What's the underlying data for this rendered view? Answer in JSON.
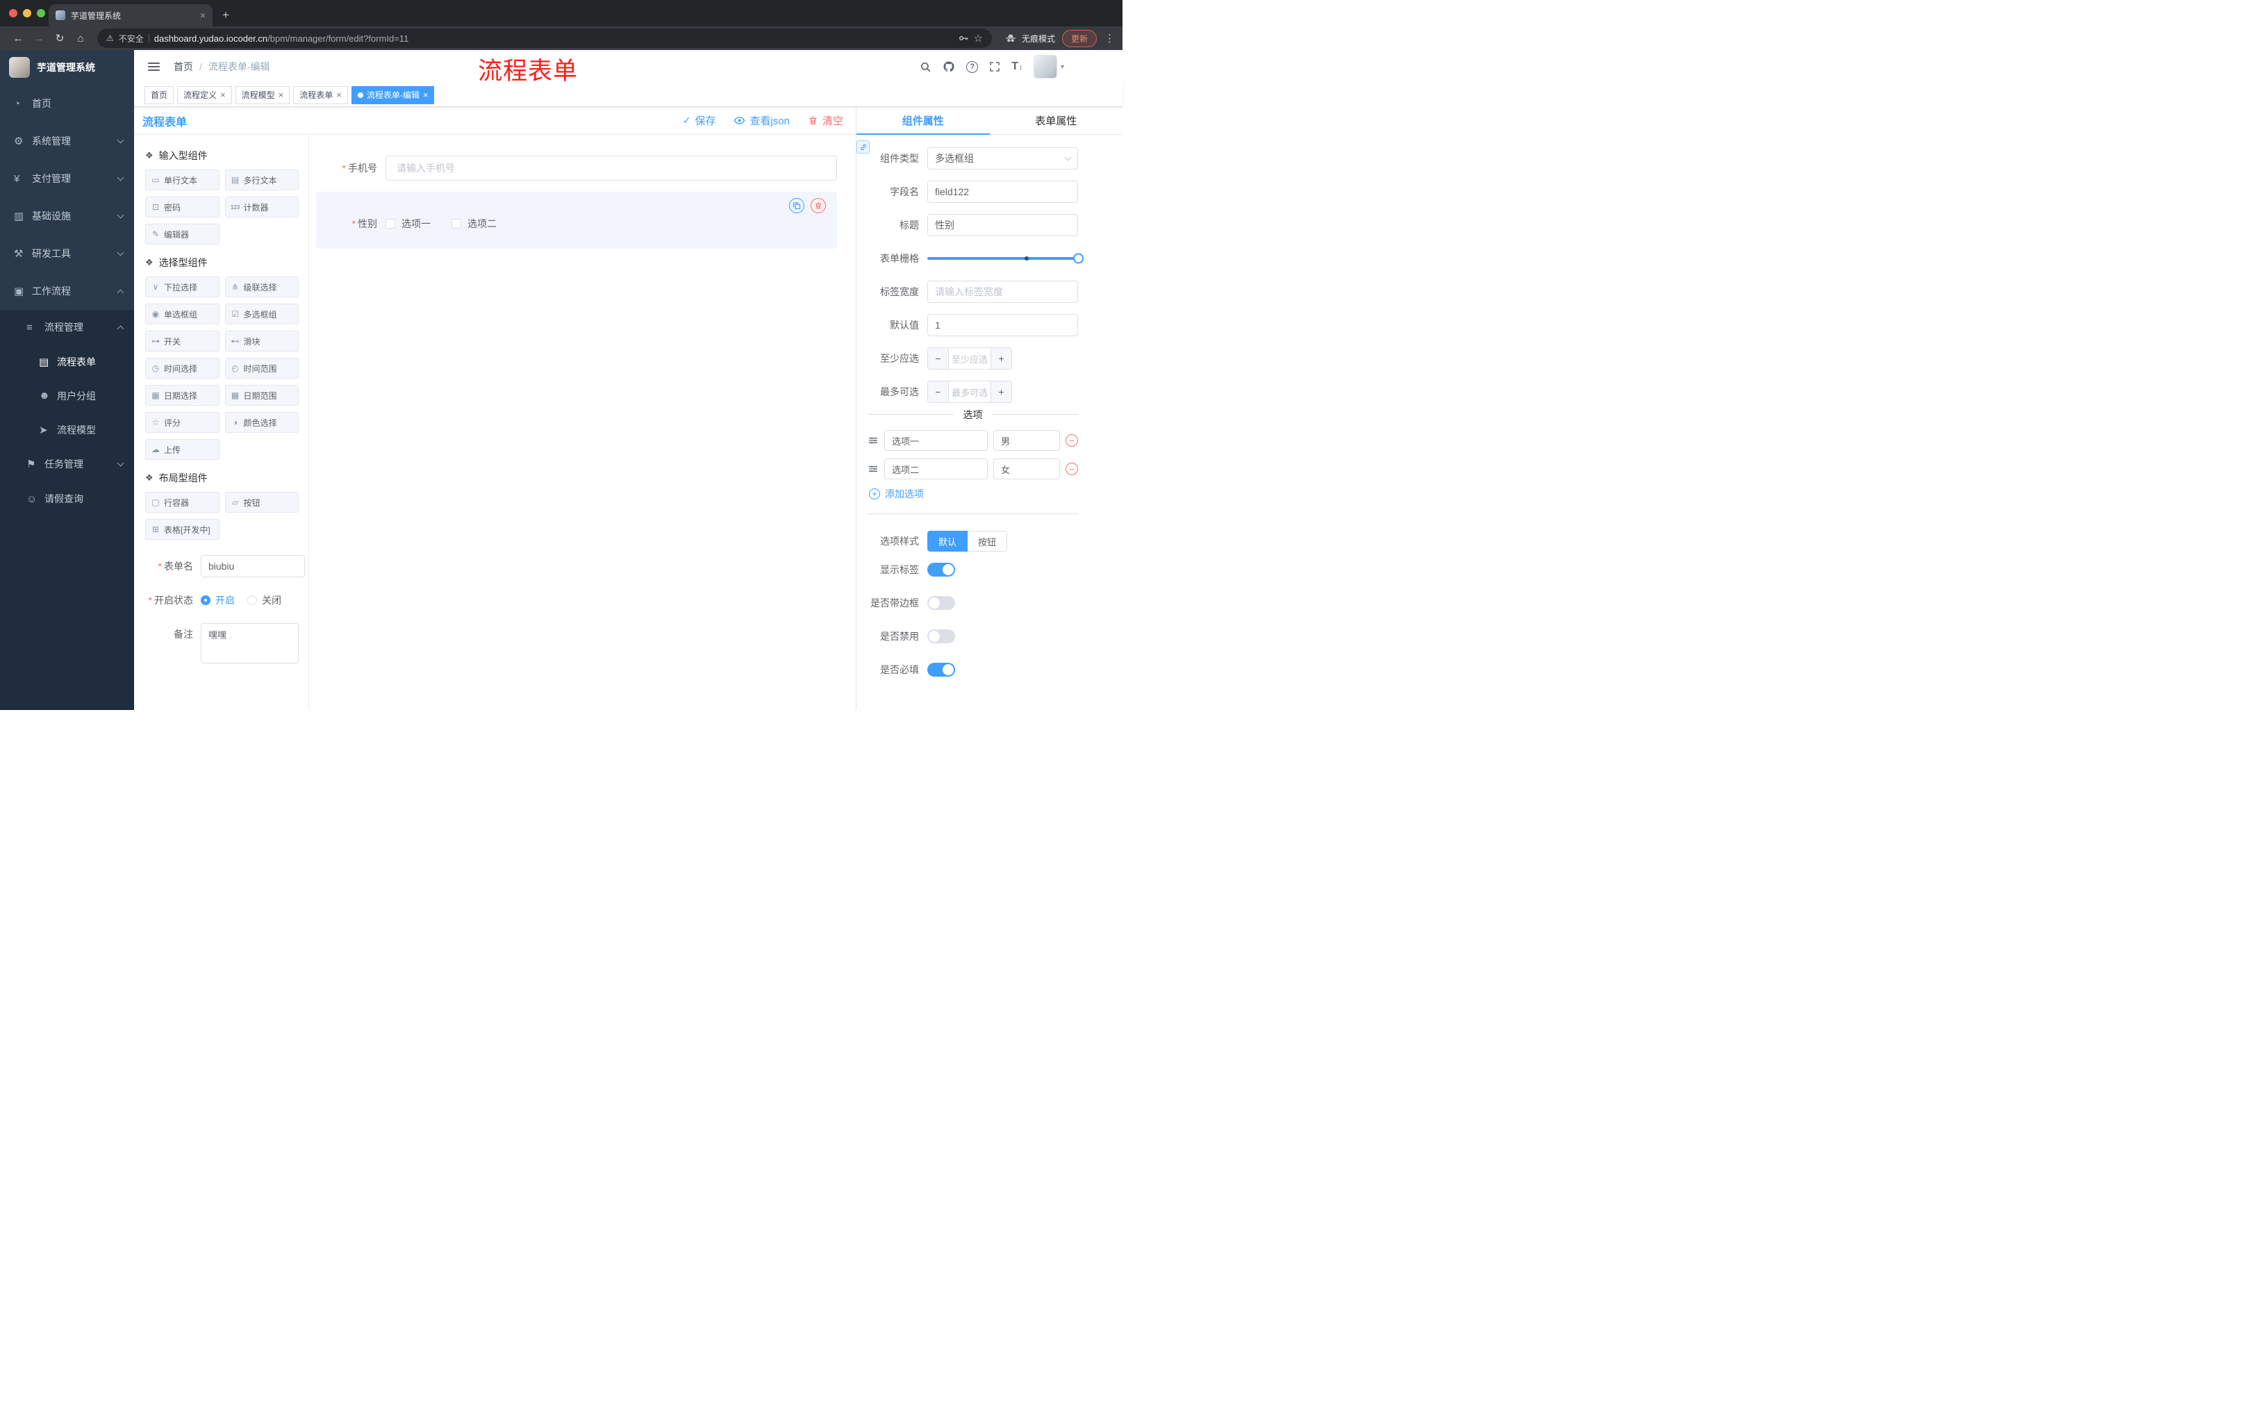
{
  "colors": {
    "accent": "#409eff",
    "danger": "#f56c6c",
    "sidebar_bg": "#2b3a4a",
    "submenu_bg": "#1f2d3c",
    "active_tag": "#409eff",
    "annotation": "#fc1f16"
  },
  "icons": {
    "required": "*",
    "slash": "/",
    "close": "×",
    "plus": "+",
    "minus": "−",
    "check": "✓",
    "dots_menu": "⋮",
    "back": "←",
    "forward": "→",
    "reload": "↻",
    "home": "⌂",
    "warning": "⚠",
    "star": "☆",
    "caret": "▾",
    "question": "?",
    "font_size": "T",
    "font_updown": "↕",
    "dashboard": "◔",
    "gear": "⚙",
    "yen": "¥",
    "monitor": "▥",
    "tools": "⚒",
    "workflow": "▣",
    "list": "≡",
    "doc": "▤",
    "users": "☻",
    "send": "➤",
    "flag": "⚑",
    "user": "☺",
    "component_group": "❖",
    "chip": {
      "single_text": "▭",
      "multi_text": "▤",
      "password": "⊡",
      "counter": "123",
      "editor": "✎",
      "select": "∨",
      "cascade": "⋔",
      "radio": "◉",
      "checkbox": "☑",
      "switch": "⊶",
      "slider": "⊷",
      "time": "◷",
      "time_range": "◴",
      "date": "▦",
      "date_range": "▩",
      "rate": "☆",
      "color": "◑",
      "upload": "☁",
      "row": "▢",
      "button": "▱",
      "table": "⊞"
    }
  },
  "browser": {
    "tab": {
      "title": "芋道管理系统"
    },
    "address": {
      "security": "不安全",
      "url_domain": "dashboard.yudao.iocoder.cn",
      "url_path": "/bpm/manager/form/edit?formId=11",
      "incognito": "无痕模式",
      "update": "更新"
    }
  },
  "sidebar": {
    "title": "芋道管理系统",
    "top_items": [
      "首页",
      "系统管理",
      "支付管理",
      "基础设施",
      "研发工具",
      "工作流程"
    ],
    "sub": {
      "process_group": "流程管理",
      "process_children": [
        "流程表单",
        "用户分组",
        "流程模型"
      ],
      "task_group": "任务管理",
      "leave_item": "请假查询"
    }
  },
  "header": {
    "breadcrumb_home": "首页",
    "breadcrumb_current": "流程表单-编辑",
    "annotation": "流程表单"
  },
  "tags": [
    {
      "label": "首页"
    },
    {
      "label": "流程定义"
    },
    {
      "label": "流程模型"
    },
    {
      "label": "流程表单"
    },
    {
      "label": "流程表单-编辑"
    }
  ],
  "workspace": {
    "panel_title": "流程表单",
    "toolbar": {
      "save": "保存",
      "view_json": "查看json",
      "clear": "清空"
    }
  },
  "palette": {
    "groups": [
      {
        "title": "输入型组件",
        "items": [
          "单行文本",
          "多行文本",
          "密码",
          "计数器",
          "编辑器"
        ]
      },
      {
        "title": "选择型组件",
        "items": [
          "下拉选择",
          "级联选择",
          "单选框组",
          "多选框组",
          "开关",
          "滑块",
          "时间选择",
          "时间范围",
          "日期选择",
          "日期范围",
          "评分",
          "颜色选择",
          "上传"
        ]
      },
      {
        "title": "布局型组件",
        "items": [
          "行容器",
          "按钮",
          "表格[开发中]"
        ]
      }
    ],
    "form": {
      "name_label": "表单名",
      "name_value": "biubiu",
      "status_label": "开启状态",
      "status_on": "开启",
      "status_off": "关闭",
      "remark_label": "备注",
      "remark_value": "嘿嘿"
    }
  },
  "canvas": {
    "phone_label": "手机号",
    "phone_placeholder": "请输入手机号",
    "gender_label": "性别",
    "gender_options": [
      "选项一",
      "选项二"
    ]
  },
  "props": {
    "tab_component": "组件属性",
    "tab_form": "表单属性",
    "component_type_label": "组件类型",
    "component_type_value": "多选框组",
    "field_name_label": "字段名",
    "field_name_value": "field122",
    "title_label": "标题",
    "title_value": "性别",
    "grid_label": "表单栅格",
    "label_width_label": "标签宽度",
    "label_width_placeholder": "请输入标签宽度",
    "default_label": "默认值",
    "default_value": "1",
    "min_label": "至少应选",
    "min_placeholder": "至少应选",
    "max_label": "最多可选",
    "max_placeholder": "最多可选",
    "options_title": "选项",
    "options": [
      {
        "label": "选项一",
        "value": "男"
      },
      {
        "label": "选项二",
        "value": "女"
      }
    ],
    "add_option": "添加选项",
    "style_label": "选项样式",
    "style_default": "默认",
    "style_button": "按钮",
    "toggles": [
      {
        "label": "显示标签",
        "on": true
      },
      {
        "label": "是否带边框",
        "on": false
      },
      {
        "label": "是否禁用",
        "on": false
      },
      {
        "label": "是否必填",
        "on": true
      }
    ]
  }
}
